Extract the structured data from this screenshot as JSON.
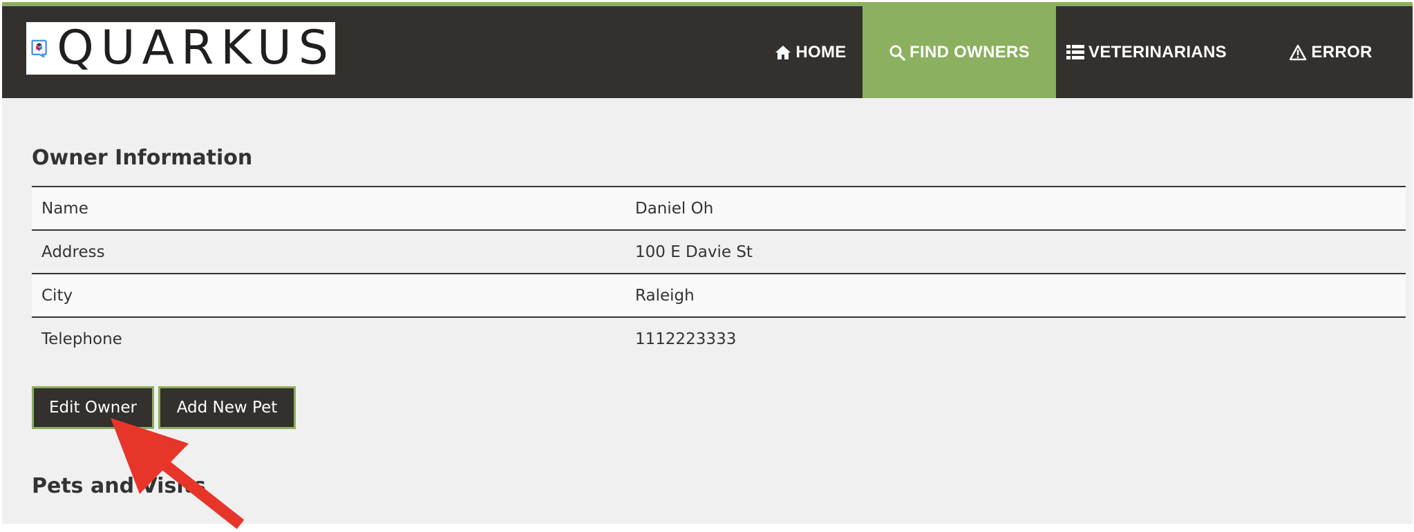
{
  "brand": {
    "logo_text": "QUARKUS"
  },
  "nav": {
    "home": "HOME",
    "find_owners": "FIND OWNERS",
    "veterinarians": "VETERINARIANS",
    "error": "ERROR"
  },
  "owner": {
    "title": "Owner Information",
    "rows": [
      {
        "label": "Name",
        "value": "Daniel Oh"
      },
      {
        "label": "Address",
        "value": "100 E Davie St"
      },
      {
        "label": "City",
        "value": "Raleigh"
      },
      {
        "label": "Telephone",
        "value": "1112223333"
      }
    ]
  },
  "buttons": {
    "edit_owner": "Edit Owner",
    "add_new_pet": "Add New Pet"
  },
  "pets": {
    "title": "Pets and Visits"
  },
  "colors": {
    "navbar": "#34302d",
    "accent": "#8bb05f",
    "annotation_arrow": "#e8352a"
  },
  "icons": [
    "quarkus-logo-icon",
    "home-icon",
    "search-icon",
    "list-icon",
    "warning-icon",
    "annotation-arrow-icon"
  ]
}
